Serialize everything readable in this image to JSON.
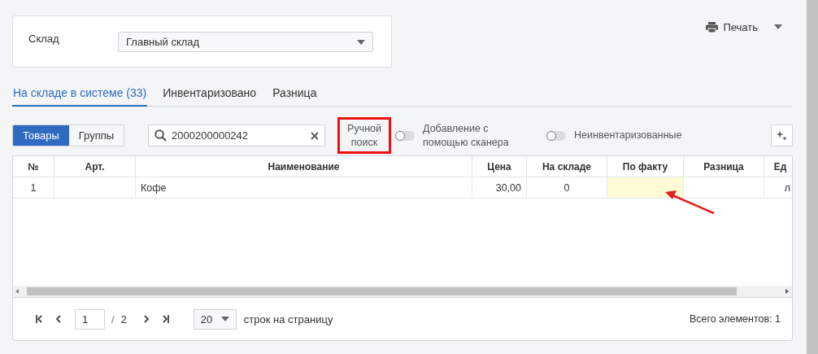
{
  "warehouse": {
    "label": "Склад",
    "value": "Главный склад"
  },
  "print": {
    "label": "Печать"
  },
  "tabs": [
    {
      "label": "На складе в системе (33)",
      "selected": true
    },
    {
      "label": "Инвентаризовано",
      "selected": false
    },
    {
      "label": "Разница",
      "selected": false
    }
  ],
  "view_switch": [
    {
      "label": "Товары",
      "selected": true
    },
    {
      "label": "Группы",
      "selected": false
    }
  ],
  "search": {
    "value": "2000200000242"
  },
  "manual_search": {
    "label": "Ручной поиск",
    "highlighted": true
  },
  "toggles": [
    {
      "label": "Добавление с помощью сканера",
      "on": false
    },
    {
      "label": "Неинвентаризованные",
      "on": false
    }
  ],
  "table": {
    "columns": [
      "№",
      "Арт.",
      "Наименование",
      "Цена",
      "На складе",
      "По факту",
      "Разница",
      "Ед"
    ],
    "rows": [
      {
        "number": "1",
        "name": "Кофе",
        "price": "30,00",
        "in_stock": "0",
        "unit": "л",
        "fact_active": true,
        "arrow": true
      }
    ]
  },
  "pagination": {
    "page": "1",
    "separator": "/",
    "total_pages": "2",
    "page_size": "20",
    "page_size_label": "строк на страницу",
    "total": "Всего элементов: 1"
  }
}
